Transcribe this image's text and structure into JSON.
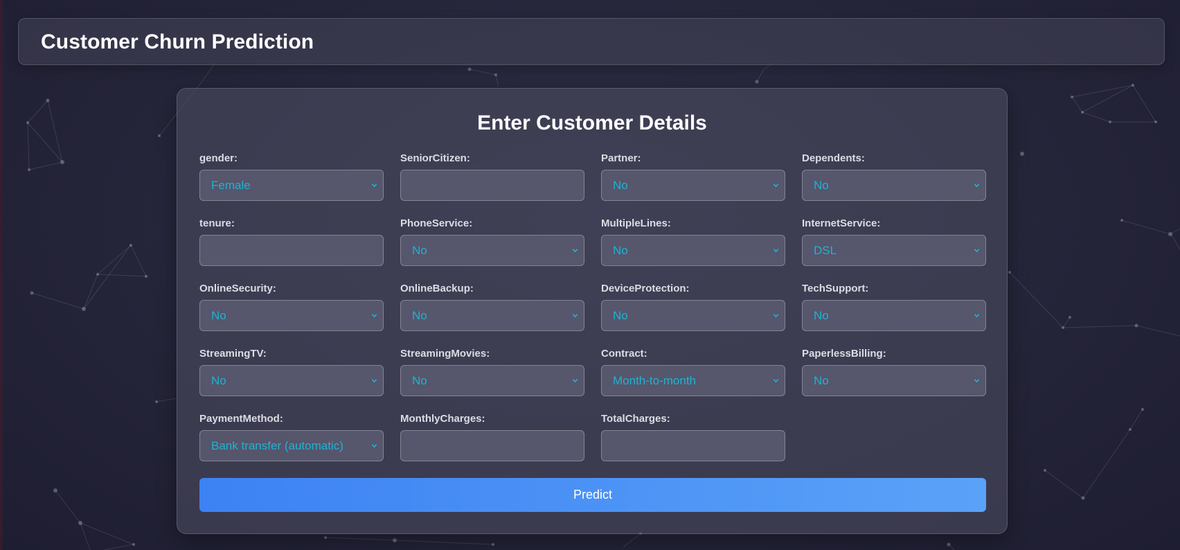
{
  "app": {
    "title": "Customer Churn Prediction"
  },
  "form": {
    "heading": "Enter Customer Details",
    "fields": [
      {
        "label": "gender:",
        "type": "select",
        "value": "Female"
      },
      {
        "label": "SeniorCitizen:",
        "type": "input",
        "value": ""
      },
      {
        "label": "Partner:",
        "type": "select",
        "value": "No"
      },
      {
        "label": "Dependents:",
        "type": "select",
        "value": "No"
      },
      {
        "label": "tenure:",
        "type": "input",
        "value": ""
      },
      {
        "label": "PhoneService:",
        "type": "select",
        "value": "No"
      },
      {
        "label": "MultipleLines:",
        "type": "select",
        "value": "No"
      },
      {
        "label": "InternetService:",
        "type": "select",
        "value": "DSL"
      },
      {
        "label": "OnlineSecurity:",
        "type": "select",
        "value": "No"
      },
      {
        "label": "OnlineBackup:",
        "type": "select",
        "value": "No"
      },
      {
        "label": "DeviceProtection:",
        "type": "select",
        "value": "No"
      },
      {
        "label": "TechSupport:",
        "type": "select",
        "value": "No"
      },
      {
        "label": "StreamingTV:",
        "type": "select",
        "value": "No"
      },
      {
        "label": "StreamingMovies:",
        "type": "select",
        "value": "No"
      },
      {
        "label": "Contract:",
        "type": "select",
        "value": "Month-to-month"
      },
      {
        "label": "PaperlessBilling:",
        "type": "select",
        "value": "No"
      },
      {
        "label": "PaymentMethod:",
        "type": "select",
        "value": "Bank transfer (automatic)"
      },
      {
        "label": "MonthlyCharges:",
        "type": "input",
        "value": ""
      },
      {
        "label": "TotalCharges:",
        "type": "input",
        "value": ""
      }
    ],
    "submit_label": "Predict"
  },
  "colors": {
    "accent": "#3d82f3",
    "select_text": "#1fb3d2",
    "background": "#25253a"
  },
  "icons": {
    "select_arrow": "chevron-down-icon"
  }
}
